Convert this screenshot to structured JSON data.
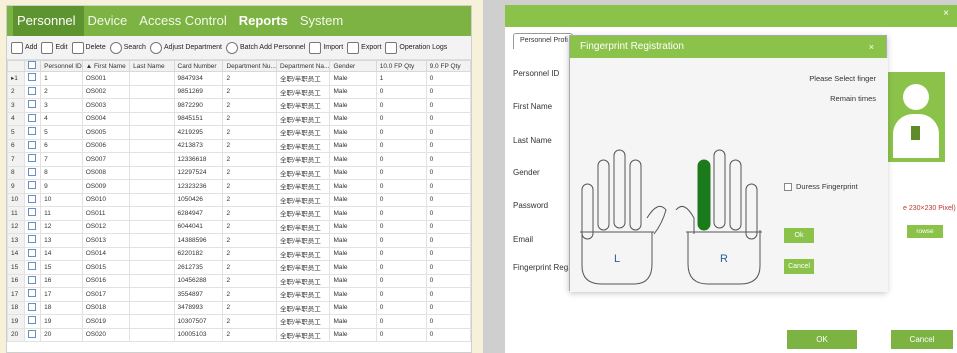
{
  "menu": {
    "items": [
      "Personnel",
      "Device",
      "Access Control",
      "Reports",
      "System"
    ]
  },
  "toolbar": {
    "add": "Add",
    "edit": "Edit",
    "delete": "Delete",
    "search": "Search",
    "adjust_department": "Adjust Department",
    "batch_add": "Batch Add Personnel",
    "import": "Import",
    "export": "Export",
    "operation_logs": "Operation Logs"
  },
  "table": {
    "headers": [
      "Personnel ID",
      "First Name",
      "Last Name",
      "Card Number",
      "Department Nu...",
      "Department Na...",
      "Gender",
      "10.0 FP Qty",
      "9.0 FP Qty"
    ],
    "sort_indicator": "▲",
    "row_marker": "▸",
    "rows": [
      {
        "n": "1",
        "id": "1",
        "first": "OS001",
        "last": "",
        "card": "9847934",
        "dept": "2",
        "dname": "全职/半职员工",
        "gender": "Male",
        "fp10": "1",
        "fp9": "0"
      },
      {
        "n": "2",
        "id": "2",
        "first": "OS002",
        "last": "",
        "card": "9851269",
        "dept": "2",
        "dname": "全职/半职员工",
        "gender": "Male",
        "fp10": "0",
        "fp9": "0"
      },
      {
        "n": "3",
        "id": "3",
        "first": "OS003",
        "last": "",
        "card": "9872290",
        "dept": "2",
        "dname": "全职/半职员工",
        "gender": "Male",
        "fp10": "0",
        "fp9": "0"
      },
      {
        "n": "4",
        "id": "4",
        "first": "OS004",
        "last": "",
        "card": "9845151",
        "dept": "2",
        "dname": "全职/半职员工",
        "gender": "Male",
        "fp10": "0",
        "fp9": "0"
      },
      {
        "n": "5",
        "id": "5",
        "first": "OS005",
        "last": "",
        "card": "4219295",
        "dept": "2",
        "dname": "全职/半职员工",
        "gender": "Male",
        "fp10": "0",
        "fp9": "0"
      },
      {
        "n": "6",
        "id": "6",
        "first": "OS006",
        "last": "",
        "card": "4213873",
        "dept": "2",
        "dname": "全职/半职员工",
        "gender": "Male",
        "fp10": "0",
        "fp9": "0"
      },
      {
        "n": "7",
        "id": "7",
        "first": "OS007",
        "last": "",
        "card": "12336618",
        "dept": "2",
        "dname": "全职/半职员工",
        "gender": "Male",
        "fp10": "0",
        "fp9": "0"
      },
      {
        "n": "8",
        "id": "8",
        "first": "OS008",
        "last": "",
        "card": "12297524",
        "dept": "2",
        "dname": "全职/半职员工",
        "gender": "Male",
        "fp10": "0",
        "fp9": "0"
      },
      {
        "n": "9",
        "id": "9",
        "first": "OS009",
        "last": "",
        "card": "12323236",
        "dept": "2",
        "dname": "全职/半职员工",
        "gender": "Male",
        "fp10": "0",
        "fp9": "0"
      },
      {
        "n": "10",
        "id": "10",
        "first": "OS010",
        "last": "",
        "card": "1050426",
        "dept": "2",
        "dname": "全职/半职员工",
        "gender": "Male",
        "fp10": "0",
        "fp9": "0"
      },
      {
        "n": "11",
        "id": "11",
        "first": "OS011",
        "last": "",
        "card": "6284947",
        "dept": "2",
        "dname": "全职/半职员工",
        "gender": "Male",
        "fp10": "0",
        "fp9": "0"
      },
      {
        "n": "12",
        "id": "12",
        "first": "OS012",
        "last": "",
        "card": "6044041",
        "dept": "2",
        "dname": "全职/半职员工",
        "gender": "Male",
        "fp10": "0",
        "fp9": "0"
      },
      {
        "n": "13",
        "id": "13",
        "first": "OS013",
        "last": "",
        "card": "14388596",
        "dept": "2",
        "dname": "全职/半职员工",
        "gender": "Male",
        "fp10": "0",
        "fp9": "0"
      },
      {
        "n": "14",
        "id": "14",
        "first": "OS014",
        "last": "",
        "card": "6220182",
        "dept": "2",
        "dname": "全职/半职员工",
        "gender": "Male",
        "fp10": "0",
        "fp9": "0"
      },
      {
        "n": "15",
        "id": "15",
        "first": "OS015",
        "last": "",
        "card": "2612735",
        "dept": "2",
        "dname": "全职/半职员工",
        "gender": "Male",
        "fp10": "0",
        "fp9": "0"
      },
      {
        "n": "16",
        "id": "16",
        "first": "OS016",
        "last": "",
        "card": "10456288",
        "dept": "2",
        "dname": "全职/半职员工",
        "gender": "Male",
        "fp10": "0",
        "fp9": "0"
      },
      {
        "n": "17",
        "id": "17",
        "first": "OS017",
        "last": "",
        "card": "3554897",
        "dept": "2",
        "dname": "全职/半职员工",
        "gender": "Male",
        "fp10": "0",
        "fp9": "0"
      },
      {
        "n": "18",
        "id": "18",
        "first": "OS018",
        "last": "",
        "card": "3478993",
        "dept": "2",
        "dname": "全职/半职员工",
        "gender": "Male",
        "fp10": "0",
        "fp9": "0"
      },
      {
        "n": "19",
        "id": "19",
        "first": "OS019",
        "last": "",
        "card": "10307507",
        "dept": "2",
        "dname": "全职/半职员工",
        "gender": "Male",
        "fp10": "0",
        "fp9": "0"
      },
      {
        "n": "20",
        "id": "20",
        "first": "OS020",
        "last": "",
        "card": "10005103",
        "dept": "2",
        "dname": "全职/半职员工",
        "gender": "Male",
        "fp10": "0",
        "fp9": "0"
      }
    ]
  },
  "personnel_form": {
    "tab": "Personnel Profi",
    "close": "×",
    "labels": [
      "Personnel ID",
      "First Name",
      "Last Name",
      "Gender",
      "Password",
      "Email",
      "Fingerprint Reg."
    ],
    "photo_hint": "e 230×230 Pixel)",
    "browse": "rowse",
    "ok": "OK",
    "cancel": "Cancel"
  },
  "fingerprint_dialog": {
    "title": "Fingerprint Registration",
    "close": "×",
    "select_finger": "Please Select finger",
    "remain_times": "Remain times",
    "duress": "Duress Fingerprint",
    "ok": "Ok",
    "cancel": "Cancel",
    "left_hand": "L",
    "right_hand": "R",
    "selected_finger": "right-index"
  },
  "colors": {
    "accent": "#8bc34a",
    "menu_bar": "#7cb342",
    "menu_active": "#5e9430",
    "finger_selected": "#1b7a1b"
  },
  "icons": [
    "add-icon",
    "edit-icon",
    "delete-icon",
    "search-icon",
    "department-icon",
    "batch-add-icon",
    "import-icon",
    "export-icon",
    "operation-logs-icon"
  ]
}
